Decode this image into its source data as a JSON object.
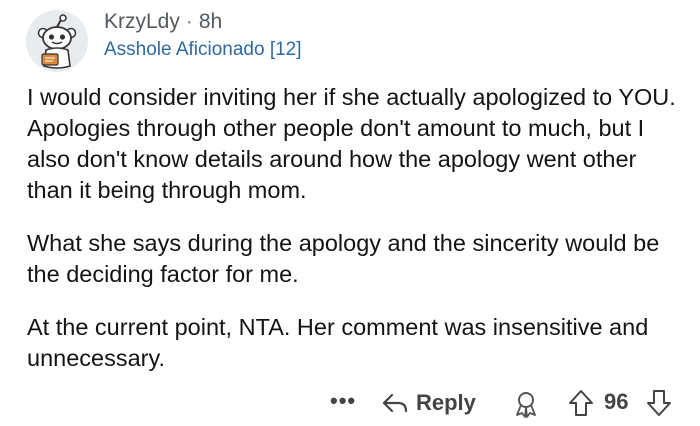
{
  "comment": {
    "author": "KrzyLdy",
    "separator": "·",
    "age": "8h",
    "flair": "Asshole Aficionado [12]",
    "paragraphs": [
      "I would consider inviting her if she actually apologized to YOU. Apologies through other people don't amount to much, but I also don't know details around how the apology went other than it being through mom.",
      "What she says during the apology and the sincerity would be the deciding factor for me.",
      "At the current point, NTA. Her comment was insensitive and unnecessary."
    ]
  },
  "actions": {
    "more_label": "•••",
    "reply_label": "Reply",
    "score": "96"
  },
  "icons": {
    "avatar": "snoo-avatar-icon",
    "reply": "reply-arrow-icon",
    "award": "award-icon",
    "upvote": "upvote-arrow-icon",
    "downvote": "downvote-arrow-icon"
  },
  "colors": {
    "flair": "#2e6aa0",
    "meta": "#555a5e",
    "text": "#141414",
    "actions": "#444444"
  }
}
